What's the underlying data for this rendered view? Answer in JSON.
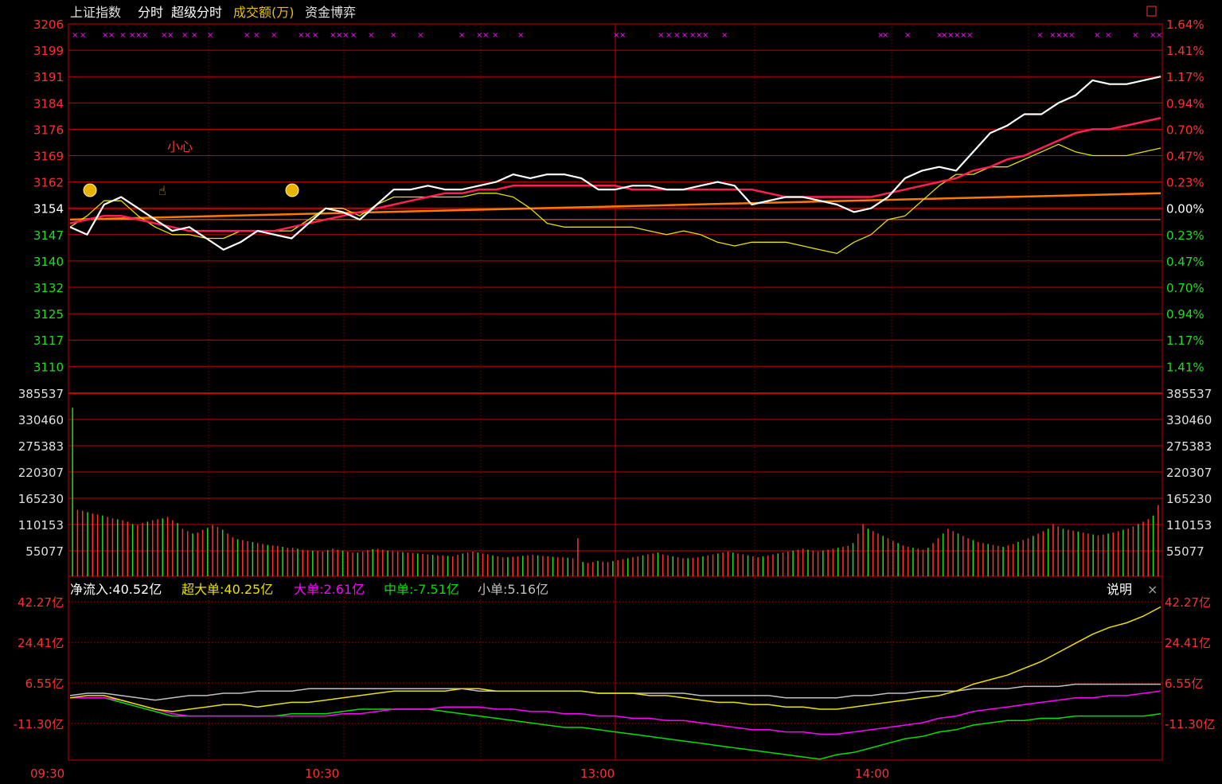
{
  "toolbar": {
    "items": [
      "上证指数",
      "分时",
      "超级分时",
      "成交额(万)",
      "资金博弈"
    ],
    "active_index": 3,
    "colors": [
      "#e0e0e0",
      "#ffffff",
      "#ffffff",
      "#e8c000",
      "#e0e0e0"
    ]
  },
  "price_panel": {
    "y_labels": [
      "3206",
      "3199",
      "3191",
      "3184",
      "3176",
      "3169",
      "3162",
      "3154",
      "3147",
      "3140",
      "3132",
      "3125",
      "3117",
      "3110"
    ],
    "pct_labels": [
      "1.64%",
      "1.41%",
      "1.17%",
      "0.94%",
      "0.70%",
      "0.47%",
      "0.23%",
      "0.00%",
      "0.23%",
      "0.47%",
      "0.70%",
      "0.94%",
      "1.17%",
      "1.41%"
    ],
    "annotation": "小心",
    "prev_close": 3154,
    "series": {
      "price": [
        3152,
        3150,
        3158,
        3160,
        3157,
        3154,
        3151,
        3152,
        3149,
        3146,
        3148,
        3151,
        3150,
        3149,
        3153,
        3157,
        3156,
        3154,
        3158,
        3162,
        3162,
        3163,
        3162,
        3162,
        3163,
        3164,
        3166,
        3165,
        3166,
        3166,
        3165,
        3162,
        3162,
        3163,
        3163,
        3162,
        3162,
        3163,
        3164,
        3163,
        3158,
        3159,
        3160,
        3160,
        3159,
        3158,
        3156,
        3157,
        3160,
        3165,
        3167,
        3168,
        3167,
        3172,
        3177,
        3179,
        3182,
        3182,
        3185,
        3187,
        3191,
        3190,
        3190,
        3191,
        3192
      ],
      "avg": [
        3153,
        3154,
        3155,
        3155,
        3154,
        3153,
        3152,
        3151,
        3151,
        3151,
        3151,
        3151,
        3151,
        3152,
        3153,
        3154,
        3155,
        3156,
        3157,
        3158,
        3159,
        3160,
        3161,
        3161,
        3162,
        3162,
        3163,
        3163,
        3163,
        3163,
        3163,
        3163,
        3163,
        3162,
        3162,
        3162,
        3162,
        3162,
        3162,
        3162,
        3162,
        3161,
        3160,
        3160,
        3160,
        3160,
        3160,
        3160,
        3161,
        3162,
        3163,
        3164,
        3165,
        3167,
        3168,
        3170,
        3171,
        3173,
        3175,
        3177,
        3178,
        3178,
        3179,
        3180,
        3181
      ],
      "yellow": [
        3152,
        3155,
        3159,
        3159,
        3155,
        3152,
        3150,
        3150,
        3149,
        3149,
        3151,
        3151,
        3151,
        3151,
        3154,
        3157,
        3157,
        3155,
        3158,
        3160,
        3160,
        3160,
        3160,
        3160,
        3161,
        3161,
        3160,
        3157,
        3153,
        3152,
        3152,
        3152,
        3152,
        3152,
        3151,
        3150,
        3151,
        3150,
        3148,
        3147,
        3148,
        3148,
        3148,
        3147,
        3146,
        3145,
        3148,
        3150,
        3154,
        3155,
        3159,
        3163,
        3166,
        3166,
        3168,
        3168,
        3170,
        3172,
        3174,
        3172,
        3171,
        3171,
        3171,
        3172,
        3173
      ],
      "orange_start": 3154,
      "orange_end": 3161
    }
  },
  "volume_panel": {
    "y_labels": [
      "385537",
      "330460",
      "275383",
      "220307",
      "165230",
      "110153",
      "55077"
    ],
    "max": 385537,
    "bars": [
      355000,
      140000,
      138000,
      135000,
      132000,
      130000,
      128000,
      125000,
      122000,
      120000,
      118000,
      115000,
      110000,
      108000,
      112000,
      115000,
      118000,
      120000,
      122000,
      125000,
      118000,
      112000,
      100000,
      95000,
      90000,
      92000,
      98000,
      102000,
      108000,
      104000,
      98000,
      90000,
      82000,
      78000,
      76000,
      74000,
      72000,
      70000,
      68000,
      66000,
      65000,
      64000,
      62000,
      60000,
      60000,
      58000,
      56000,
      55000,
      54000,
      53000,
      52000,
      55000,
      58000,
      56000,
      54000,
      52000,
      50000,
      50000,
      52000,
      55000,
      57000,
      58000,
      56000,
      54000,
      53000,
      52000,
      51000,
      50000,
      49000,
      48000,
      47000,
      46000,
      45000,
      44000,
      44000,
      43000,
      42000,
      45000,
      48000,
      50000,
      52000,
      50000,
      48000,
      46000,
      44000,
      42000,
      40000,
      40000,
      41000,
      42000,
      43000,
      44000,
      45000,
      44000,
      43000,
      42000,
      41000,
      40000,
      40000,
      39000,
      38000,
      80000,
      30000,
      28000,
      30000,
      32000,
      31000,
      30000,
      32000,
      34000,
      36000,
      38000,
      40000,
      42000,
      44000,
      46000,
      48000,
      50000,
      46000,
      44000,
      42000,
      40000,
      38000,
      38000,
      39000,
      40000,
      42000,
      44000,
      46000,
      48000,
      50000,
      52000,
      50000,
      48000,
      46000,
      44000,
      42000,
      40000,
      42000,
      44000,
      46000,
      48000,
      50000,
      52000,
      54000,
      56000,
      58000,
      56000,
      54000,
      52000,
      54000,
      56000,
      58000,
      60000,
      62000,
      64000,
      70000,
      90000,
      110000,
      100000,
      95000,
      90000,
      85000,
      80000,
      75000,
      70000,
      65000,
      62000,
      60000,
      58000,
      56000,
      60000,
      70000,
      80000,
      90000,
      100000,
      95000,
      90000,
      85000,
      80000,
      76000,
      72000,
      70000,
      68000,
      66000,
      64000,
      62000,
      65000,
      68000,
      72000,
      76000,
      80000,
      85000,
      90000,
      95000,
      100000,
      110000,
      105000,
      100000,
      98000,
      96000,
      94000,
      92000,
      90000,
      88000,
      86000,
      88000,
      90000,
      92000,
      95000,
      98000,
      100000,
      105000,
      110000,
      115000,
      120000,
      128000,
      150000
    ]
  },
  "flow_panel": {
    "legend": {
      "net": "净流入:40.52亿",
      "super": "超大单:40.25亿",
      "large": "大单:2.61亿",
      "medium": "中单:-7.51亿",
      "small": "小单:5.16亿"
    },
    "help": "说明",
    "close": "×",
    "y_labels": [
      "42.27亿",
      "24.41亿",
      "6.55亿",
      "-11.30亿"
    ],
    "series": {
      "super": [
        0,
        1,
        1,
        -1,
        -3,
        -5,
        -6,
        -5,
        -4,
        -3,
        -3,
        -4,
        -3,
        -2,
        -2,
        -1,
        0,
        1,
        2,
        3,
        3,
        3,
        3,
        4,
        4,
        3,
        3,
        3,
        3,
        3,
        3,
        2,
        2,
        2,
        1,
        1,
        0,
        -1,
        -2,
        -2,
        -3,
        -3,
        -4,
        -4,
        -5,
        -5,
        -4,
        -3,
        -2,
        -1,
        0,
        1,
        3,
        6,
        8,
        10,
        13,
        16,
        20,
        24,
        28,
        31,
        33,
        36,
        40
      ],
      "large": [
        0,
        0,
        0,
        -1,
        -3,
        -5,
        -7,
        -8,
        -8,
        -8,
        -8,
        -8,
        -8,
        -8,
        -8,
        -8,
        -7,
        -7,
        -6,
        -5,
        -5,
        -5,
        -4,
        -4,
        -4,
        -5,
        -5,
        -6,
        -6,
        -7,
        -7,
        -8,
        -8,
        -9,
        -9,
        -10,
        -10,
        -11,
        -12,
        -13,
        -14,
        -14,
        -15,
        -15,
        -16,
        -16,
        -15,
        -14,
        -13,
        -12,
        -11,
        -9,
        -8,
        -6,
        -5,
        -4,
        -3,
        -2,
        -1,
        0,
        0,
        1,
        1,
        2,
        3
      ],
      "medium": [
        0,
        0,
        0,
        -2,
        -4,
        -6,
        -8,
        -8,
        -8,
        -8,
        -8,
        -8,
        -8,
        -7,
        -7,
        -7,
        -6,
        -5,
        -5,
        -5,
        -5,
        -5,
        -6,
        -7,
        -8,
        -9,
        -10,
        -11,
        -12,
        -13,
        -13,
        -14,
        -15,
        -16,
        -17,
        -18,
        -19,
        -20,
        -21,
        -22,
        -23,
        -24,
        -25,
        -26,
        -27,
        -25,
        -24,
        -22,
        -20,
        -18,
        -17,
        -15,
        -14,
        -12,
        -11,
        -10,
        -10,
        -9,
        -9,
        -8,
        -8,
        -8,
        -8,
        -8,
        -7
      ],
      "small": [
        1,
        2,
        2,
        1,
        0,
        -1,
        0,
        1,
        1,
        2,
        2,
        3,
        3,
        3,
        4,
        4,
        4,
        4,
        4,
        4,
        4,
        4,
        4,
        4,
        3,
        3,
        3,
        3,
        3,
        3,
        3,
        2,
        2,
        2,
        2,
        2,
        2,
        1,
        1,
        1,
        1,
        1,
        0,
        0,
        0,
        0,
        1,
        1,
        2,
        2,
        3,
        3,
        3,
        4,
        4,
        4,
        5,
        5,
        5,
        6,
        6,
        6,
        6,
        6,
        6
      ]
    },
    "ymin": -16,
    "ymax": 42.27
  },
  "x_axis": {
    "labels": [
      "09:30",
      "10:30",
      "13:00",
      "14:00"
    ]
  },
  "colors": {
    "grid": "#c40000",
    "price_line": "#ffffff",
    "avg_line": "#ff2050",
    "avg_flat": "#9060ff",
    "yellow_line": "#e8e000",
    "orange_line": "#ff7800",
    "axis_up": "#ff3030",
    "axis_down": "#22dd22",
    "volume_axis": "#e0e0e0",
    "marker": "#ff00ff",
    "super": "#e8e000",
    "large": "#ff00ff",
    "medium": "#00e000",
    "small": "#c0c0c0"
  }
}
